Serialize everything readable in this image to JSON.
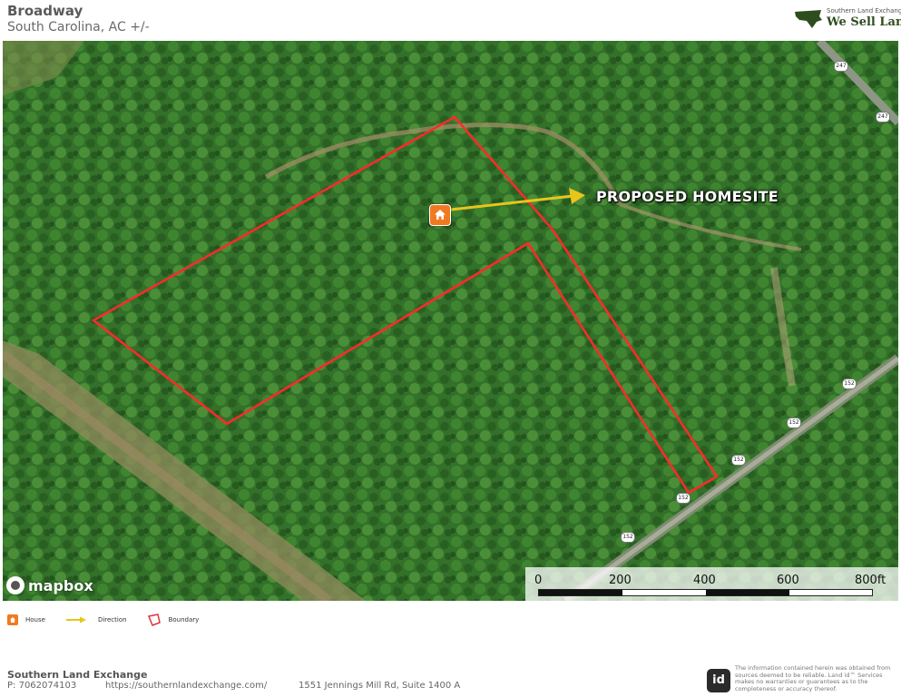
{
  "header": {
    "title": "Broadway",
    "subtitle": "South Carolina,  AC +/-",
    "logo_small": "Southern Land Exchange",
    "logo_big": "We Sell Land."
  },
  "map": {
    "callout": "PROPOSED HOMESITE",
    "attribution": "mapbox",
    "road_badges": [
      "247",
      "247",
      "152",
      "152",
      "152",
      "152",
      "152"
    ],
    "colors": {
      "boundary": "#ff2a2a",
      "arrow": "#e8c51c",
      "house_marker": "#f07a22"
    },
    "scale": {
      "unit": "ft",
      "labels": [
        "0",
        "200",
        "400",
        "600",
        "800ft"
      ]
    }
  },
  "legend": [
    {
      "icon": "house-icon",
      "label": "House"
    },
    {
      "icon": "direction-arrow-icon",
      "label": "Direction"
    },
    {
      "icon": "boundary-icon",
      "label": "Boundary"
    }
  ],
  "footer": {
    "company": "Southern Land Exchange",
    "phone": "P: 7062074103",
    "website": "https://southernlandexchange.com/",
    "address": "1551 Jennings Mill Rd, Suite 1400 A",
    "badge": "id",
    "disclaimer": "The information contained herein was obtained from sources deemed to be reliable. Land id™ Services makes no warranties or guarantees as to the completeness or accuracy thereof."
  }
}
